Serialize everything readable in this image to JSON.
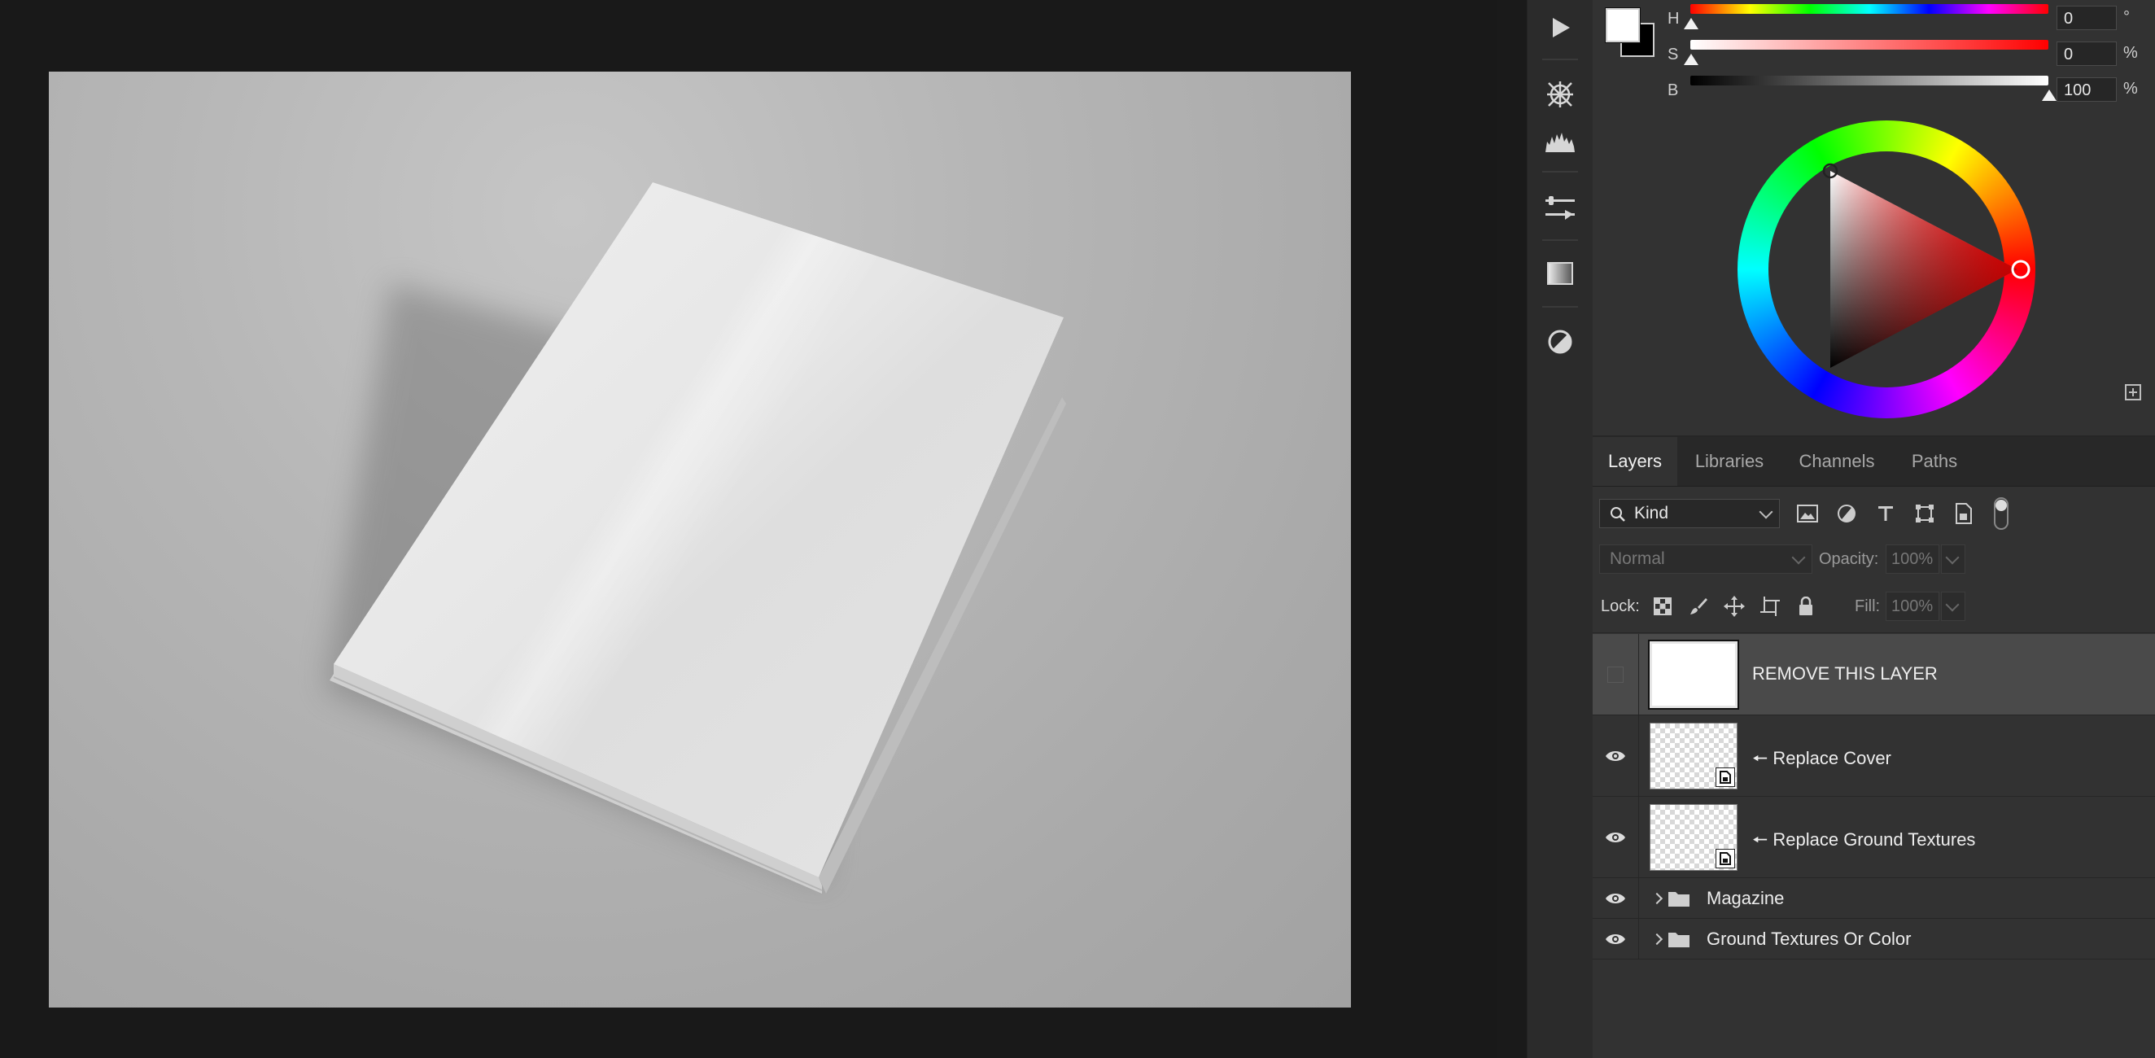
{
  "colors": {
    "canvas_bg": "#191919",
    "panel_bg": "#323232",
    "accent_selected_row": "#4a4a4a"
  },
  "tools": [
    {
      "icon": "play-icon"
    },
    {
      "icon": "navigator-compass-icon"
    },
    {
      "icon": "histogram-icon"
    },
    {
      "icon": "properties-sliders-icon"
    },
    {
      "icon": "gradient-icon"
    },
    {
      "icon": "adjustments-icon"
    }
  ],
  "color_panel": {
    "foreground": "#ffffff",
    "background": "#000000",
    "sliders": [
      {
        "label": "H",
        "value": "0",
        "unit": "°",
        "position_fraction": 0.0
      },
      {
        "label": "S",
        "value": "0",
        "unit": "%",
        "position_fraction": 0.0
      },
      {
        "label": "B",
        "value": "100",
        "unit": "%",
        "position_fraction": 1.0
      }
    ]
  },
  "layers_panel": {
    "tabs": [
      {
        "label": "Layers",
        "active": true
      },
      {
        "label": "Libraries",
        "active": false
      },
      {
        "label": "Channels",
        "active": false
      },
      {
        "label": "Paths",
        "active": false
      }
    ],
    "filter": {
      "kind_label": "Kind"
    },
    "blend_mode": "Normal",
    "opacity_label": "Opacity:",
    "opacity_value": "100%",
    "lock_label": "Lock:",
    "fill_label": "Fill:",
    "fill_value": "100%",
    "layers": [
      {
        "name": "REMOVE THIS LAYER",
        "type": "pixel",
        "visible": false,
        "selected": true
      },
      {
        "name": "🠔 Replace Cover",
        "type": "smart-object",
        "visible": true,
        "selected": false
      },
      {
        "name": "🠔 Replace Ground Textures",
        "type": "smart-object",
        "visible": true,
        "selected": false
      },
      {
        "name": "Magazine",
        "type": "group",
        "visible": true,
        "selected": false
      },
      {
        "name": "Ground Textures Or Color",
        "type": "group",
        "visible": true,
        "selected": false
      }
    ]
  }
}
